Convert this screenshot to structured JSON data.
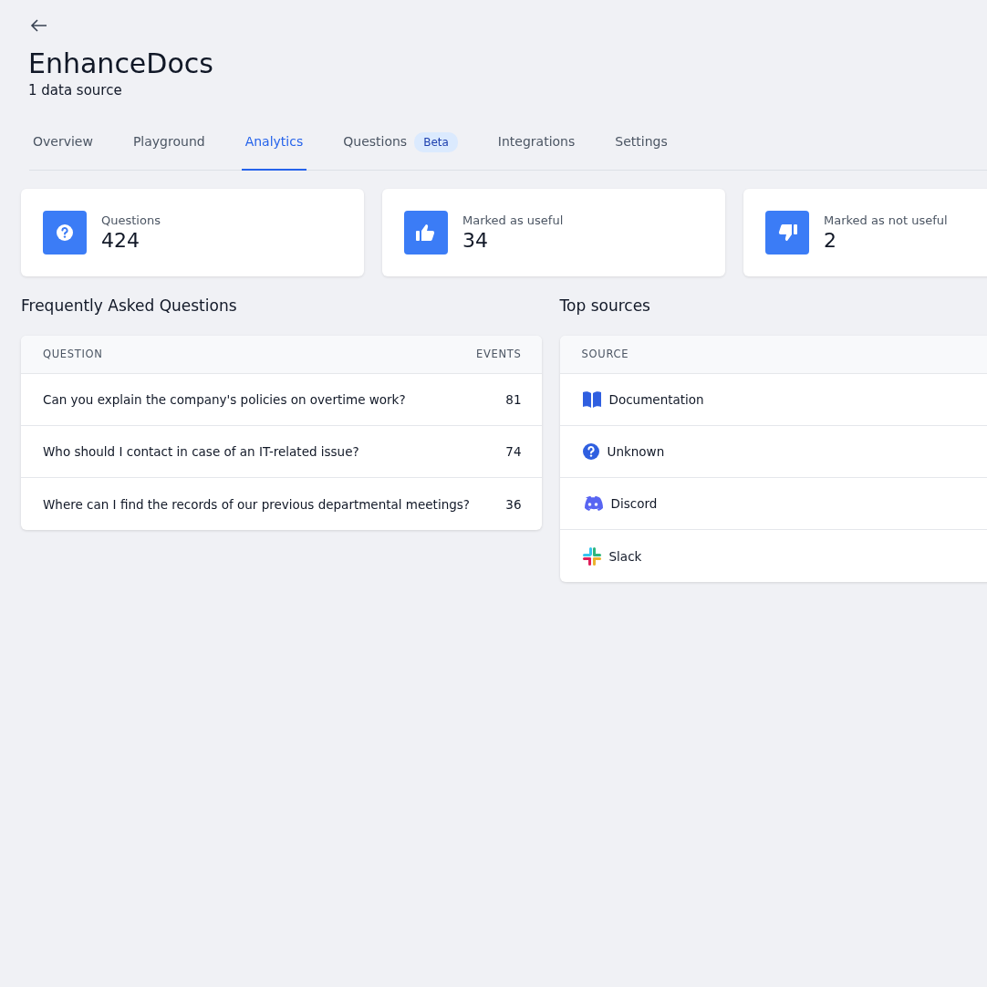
{
  "header": {
    "title": "EnhanceDocs",
    "subtitle": "1 data source"
  },
  "tabs": [
    {
      "label": "Overview",
      "selected": false
    },
    {
      "label": "Playground",
      "selected": false
    },
    {
      "label": "Analytics",
      "selected": true
    },
    {
      "label": "Questions",
      "selected": false,
      "badge": "Beta"
    },
    {
      "label": "Integrations",
      "selected": false
    },
    {
      "label": "Settings",
      "selected": false
    }
  ],
  "stats": [
    {
      "kind": "question",
      "label": "Questions",
      "value": "424"
    },
    {
      "kind": "thumbs-up",
      "label": "Marked as useful",
      "value": "34"
    },
    {
      "kind": "thumbs-down",
      "label": "Marked as not useful",
      "value": "2"
    }
  ],
  "faq": {
    "title": "Frequently Asked Questions",
    "columns": [
      "QUESTION",
      "EVENTS"
    ],
    "rows": [
      {
        "question": "Can you explain the company's policies on overtime work?",
        "events": "81"
      },
      {
        "question": "Who should I contact in case of an IT-related issue?",
        "events": "74"
      },
      {
        "question": "Where can I find the records of our previous departmental meetings?",
        "events": "36"
      }
    ]
  },
  "top_sources": {
    "title": "Top sources",
    "columns": [
      "SOURCE"
    ],
    "rows": [
      {
        "kind": "book",
        "name": "Documentation"
      },
      {
        "kind": "question",
        "name": "Unknown"
      },
      {
        "kind": "discord",
        "name": "Discord"
      },
      {
        "kind": "slack",
        "name": "Slack"
      }
    ]
  }
}
